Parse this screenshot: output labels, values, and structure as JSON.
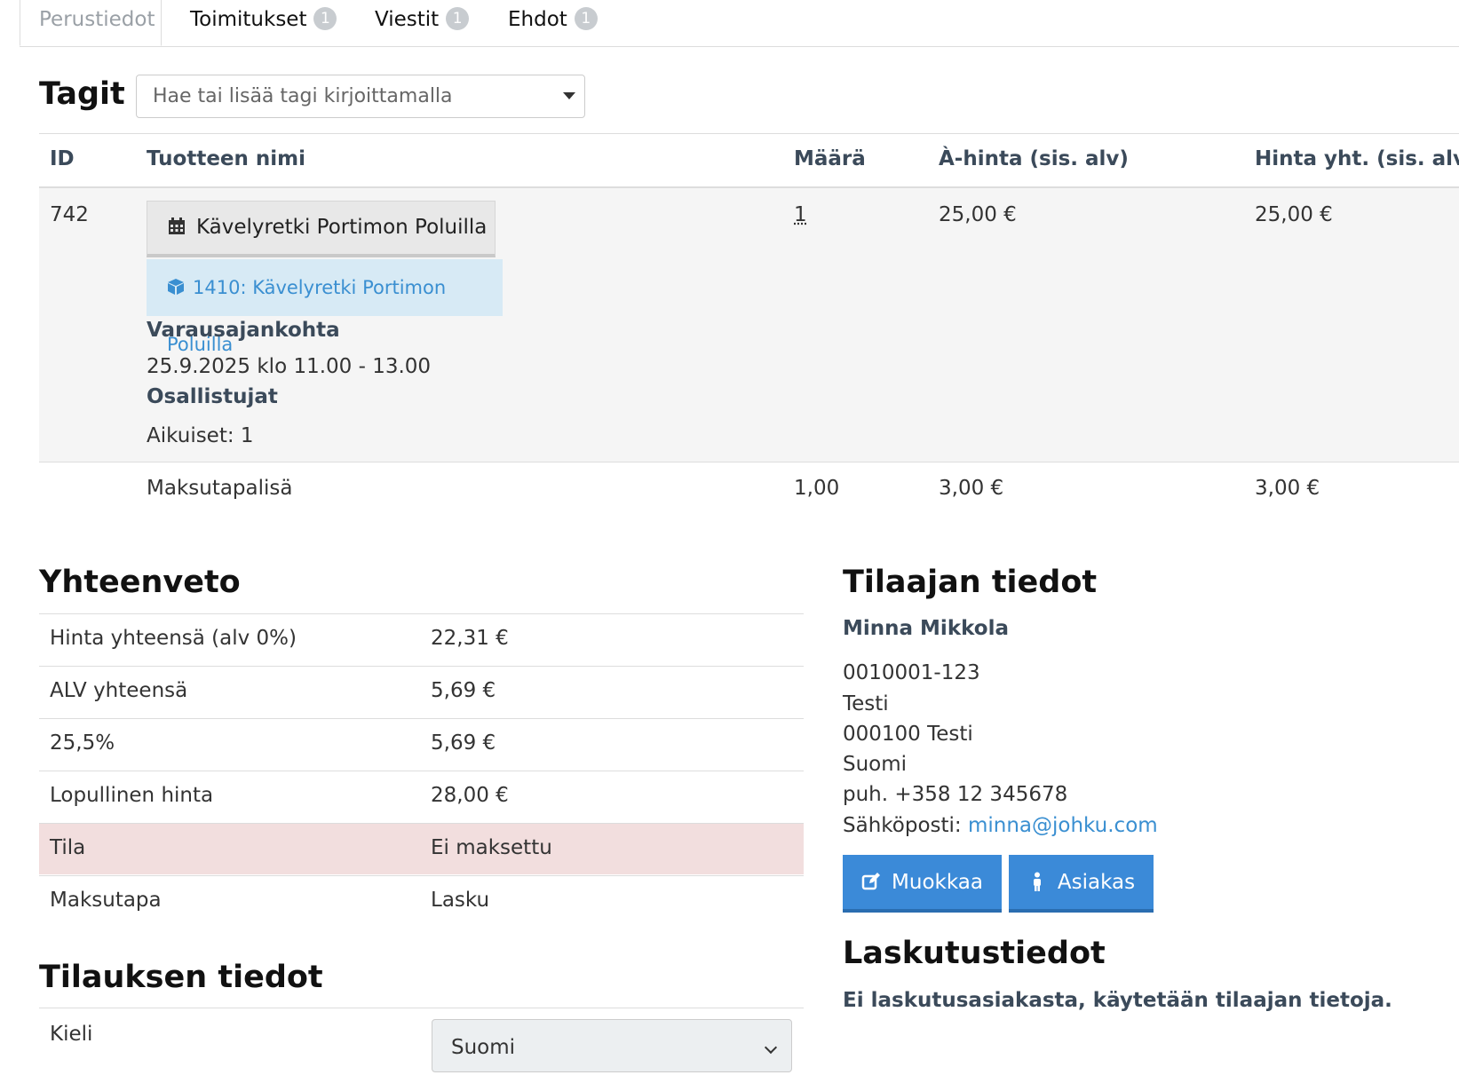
{
  "tabs": [
    {
      "label": "Perustiedot",
      "badge": ""
    },
    {
      "label": "Toimitukset",
      "badge": "1"
    },
    {
      "label": "Viestit",
      "badge": "1"
    },
    {
      "label": "Ehdot",
      "badge": "1"
    }
  ],
  "tags": {
    "heading": "Tagit",
    "placeholder": "Hae tai lisää tagi kirjoittamalla"
  },
  "products": {
    "headers": {
      "id": "ID",
      "name": "Tuotteen nimi",
      "qty": "Määrä",
      "unit_price": "À-hinta (sis. alv)",
      "total": "Hinta yht. (sis. alv)"
    },
    "rows": [
      {
        "id": "742",
        "name": "Kävelyretki Portimon Poluilla",
        "link": "1410: Kävelyretki Portimon Poluilla",
        "booking_label": "Varausajankohta",
        "booking_value": "25.9.2025 klo 11.00 - 13.00",
        "participants_label": "Osallistujat",
        "participants_value": "Aikuiset: 1",
        "qty": "1",
        "unit_price": "25,00 €",
        "total": "25,00 €"
      },
      {
        "id": "",
        "name": "Maksutapalisä",
        "qty": "1,00",
        "unit_price": "3,00 €",
        "total": "3,00 €"
      }
    ]
  },
  "summary": {
    "heading": "Yhteenveto",
    "rows": [
      {
        "label": "Hinta yhteensä (alv 0%)",
        "value": "22,31 €"
      },
      {
        "label": "ALV yhteensä",
        "value": "5,69 €"
      },
      {
        "label": "25,5%",
        "value": "5,69 €"
      },
      {
        "label": "Lopullinen hinta",
        "value": "28,00 €"
      },
      {
        "label": "Tila",
        "value": "Ei maksettu"
      },
      {
        "label": "Maksutapa",
        "value": "Lasku"
      }
    ]
  },
  "order_info": {
    "heading": "Tilauksen tiedot",
    "language_label": "Kieli",
    "language_value": "Suomi"
  },
  "customer": {
    "heading": "Tilaajan tiedot",
    "name": "Minna Mikkola",
    "id_code": "0010001-123",
    "address": "Testi",
    "postal": "000100 Testi",
    "country": "Suomi",
    "phone": "puh. +358 12 345678",
    "email_label": "Sähköposti:",
    "email": "minna@johku.com",
    "edit_button": "Muokkaa",
    "customer_button": "Asiakas"
  },
  "billing": {
    "heading": "Laskutustiedot",
    "note": "Ei laskutusasiakasta, käytetään tilaajan tietoja."
  },
  "colors": {
    "primary": "#3b8ad8",
    "link": "#3a8fd1",
    "danger_row": "#f2dede",
    "badge": "#c8ccd0"
  }
}
